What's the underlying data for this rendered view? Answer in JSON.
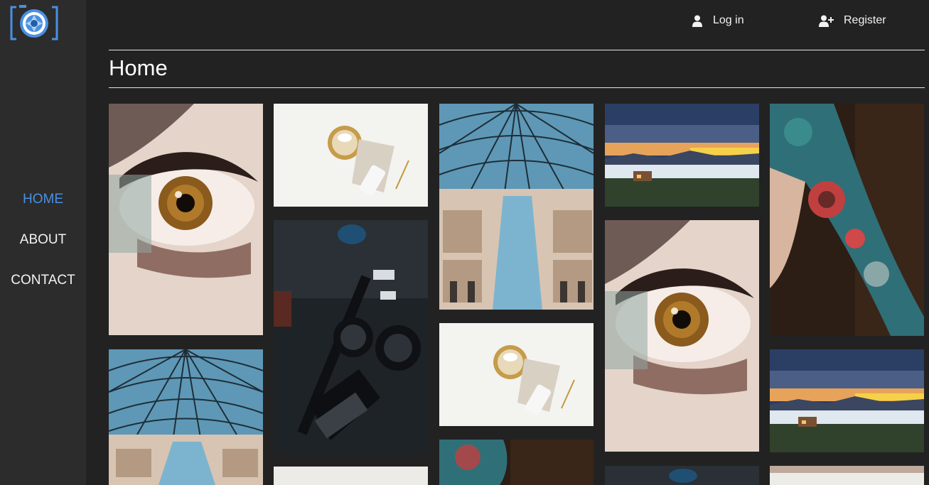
{
  "sidebar": {
    "logo": "camera-aperture-logo",
    "items": [
      {
        "label": "HOME",
        "active": true
      },
      {
        "label": "ABOUT",
        "active": false
      },
      {
        "label": "CONTACT",
        "active": false
      }
    ]
  },
  "header": {
    "login_label": "Log in",
    "register_label": "Register",
    "login_icon": "user-icon",
    "register_icon": "user-plus-icon"
  },
  "page": {
    "title": "Home"
  },
  "colors": {
    "accent": "#4a90e2",
    "background": "#222222",
    "sidebar": "#2c2c2c",
    "text": "#f2f2f2"
  },
  "gallery": {
    "columns": [
      [
        "eye-closeup",
        "glass-dome"
      ],
      [
        "coffee-cup-flatlay",
        "camera-gear",
        "coffee-cup-flatlay"
      ],
      [
        "glass-dome",
        "coffee-cup-flatlay",
        "tattoo-arm"
      ],
      [
        "mountain-sunrise",
        "eye-closeup",
        "camera-gear"
      ],
      [
        "tattoo-arm",
        "mountain-sunrise",
        "coffee-cup-flatlay"
      ]
    ]
  }
}
